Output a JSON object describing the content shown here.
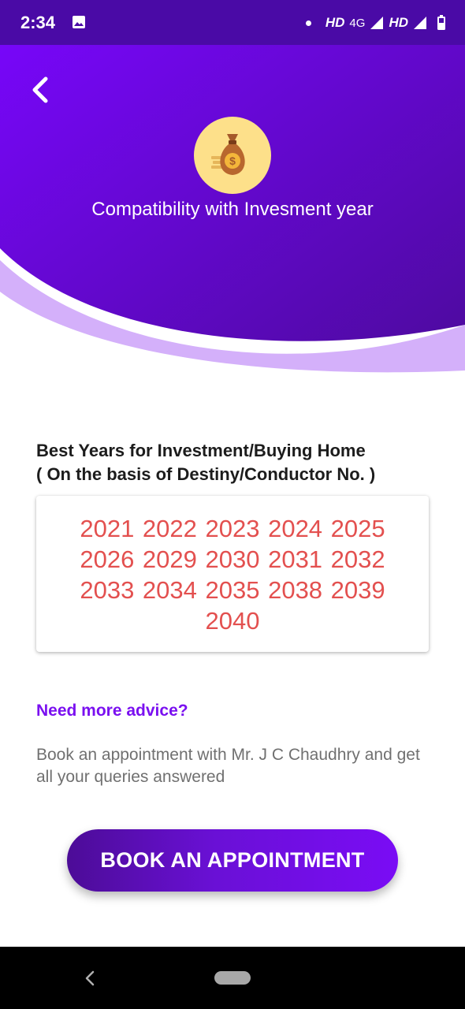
{
  "status_bar": {
    "time": "2:34",
    "network_label_1": "HD",
    "network_type": "4G",
    "network_label_2": "HD",
    "icons": [
      "image-icon",
      "notification-dot-icon",
      "signal-icon",
      "signal-icon",
      "battery-icon"
    ]
  },
  "header": {
    "title": "Compatibility with Invesment year",
    "back_icon": "chevron-left-icon",
    "feature_icon": "money-bag-icon",
    "colors": {
      "gradient_start": "#7a06ff",
      "gradient_end": "#4e0aa0",
      "wave": "#d4b0fa",
      "icon_circle": "#fde08a"
    }
  },
  "section": {
    "heading_line1": "Best Years for Investment/Buying Home",
    "heading_line2": "( On the basis of Destiny/Conductor No. )",
    "years": "2021 2022 2023 2024 2025 2026 2029 2030 2031 2032 2033 2034 2035 2038 2039 2040",
    "years_color": "#e3504f"
  },
  "advice": {
    "heading": "Need more advice?",
    "text": "Book an appointment with Mr. J C Chaudhry and get all your queries answered"
  },
  "button": {
    "label": "BOOK AN APPOINTMENT"
  },
  "nav_bar": {
    "icons": [
      "back-icon",
      "home-pill-icon"
    ]
  }
}
